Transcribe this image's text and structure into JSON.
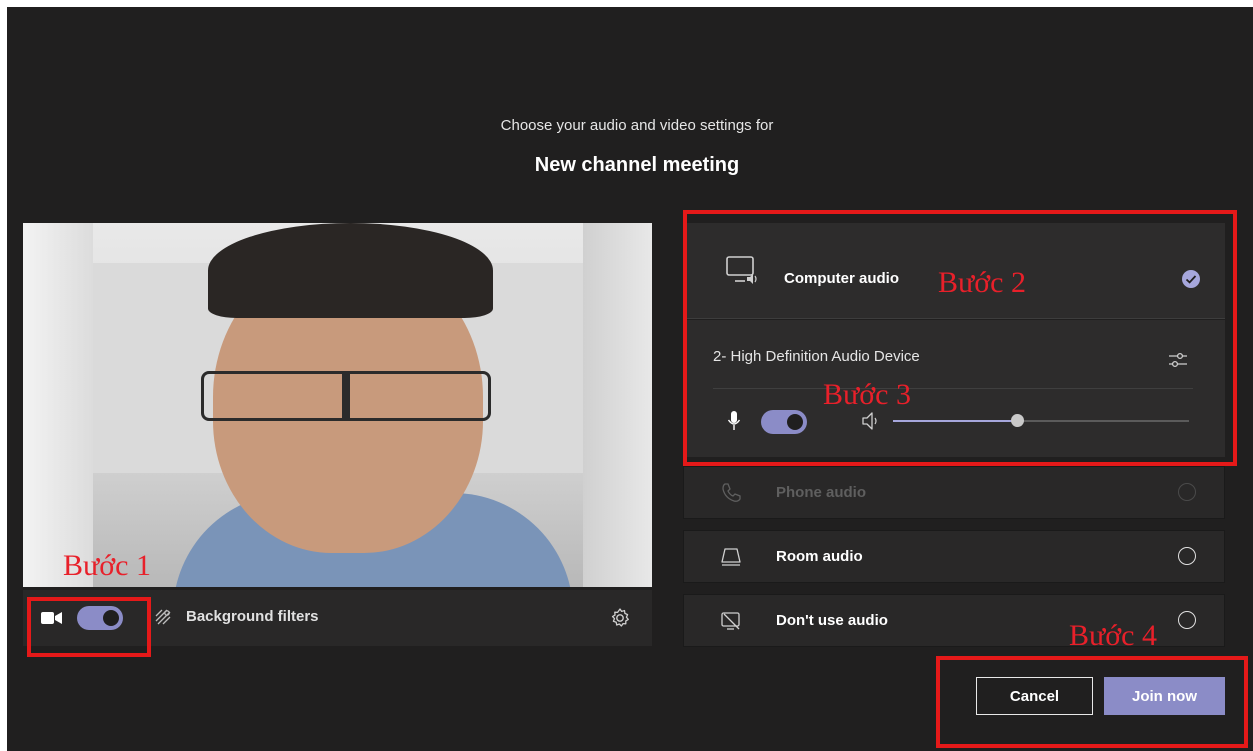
{
  "header": {
    "subtitle": "Choose your audio and video settings for",
    "title": "New channel meeting"
  },
  "video_controls": {
    "camera_toggle": "on",
    "background_filters_label": "Background filters",
    "icons": [
      "camera-icon",
      "background-filters-icon",
      "gear-icon"
    ]
  },
  "audio": {
    "computer_audio": {
      "label": "Computer audio",
      "selected": true
    },
    "device": {
      "name": "2- High Definition Audio Device"
    },
    "mic_toggle": "on",
    "speaker_volume": 0.42,
    "options": [
      {
        "label": "Phone audio",
        "enabled": false
      },
      {
        "label": "Room audio",
        "enabled": true
      },
      {
        "label": "Don't use audio",
        "enabled": true
      }
    ]
  },
  "buttons": {
    "cancel_label": "Cancel",
    "join_label": "Join now"
  },
  "annotations": {
    "step1": "Bước 1",
    "step2": "Bước 2",
    "step3": "Bước 3",
    "step4": "Bước 4"
  },
  "colors": {
    "background": "#201f1f",
    "accent": "#8b8cc7",
    "annotation_red": "#e51919"
  }
}
